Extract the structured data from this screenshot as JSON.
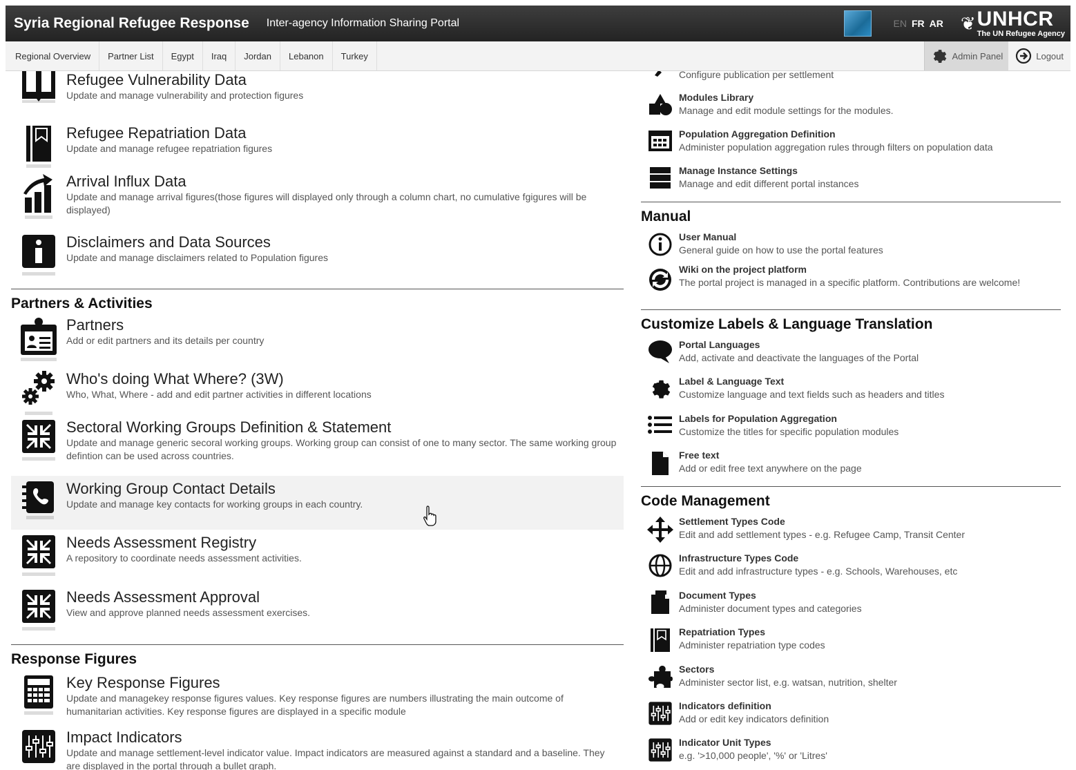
{
  "header": {
    "title": "Syria Regional Refugee Response",
    "subtitle": "Inter-agency Information Sharing Portal",
    "languages": [
      "EN",
      "FR",
      "AR"
    ],
    "logo": {
      "name": "UNHCR",
      "tagline": "The UN Refugee Agency"
    }
  },
  "nav": {
    "items": [
      "Regional Overview",
      "Partner List",
      "Egypt",
      "Iraq",
      "Jordan",
      "Lebanon",
      "Turkey"
    ],
    "admin_label": "Admin Panel",
    "logout_label": "Logout"
  },
  "left": {
    "top_items": [
      {
        "title": "Refugee Vulnerability Data",
        "desc": "Update and manage vulnerability and protection figures",
        "icon": "book-icon"
      },
      {
        "title": "Refugee Repatriation Data",
        "desc": "Update and manage refugee repatriation figures",
        "icon": "bookmark-icon"
      },
      {
        "title": "Arrival Influx Data",
        "desc": "Update and manage arrival figures(those figures will displayed only through a column chart, no cumulative fgigures will be displayed)",
        "icon": "chart-up-icon"
      },
      {
        "title": "Disclaimers and Data Sources",
        "desc": "Update and manage disclaimers related to Population figures",
        "icon": "info-icon"
      }
    ],
    "partners_section": {
      "title": "Partners & Activities",
      "items": [
        {
          "title": "Partners",
          "desc": "Add or edit partners and its details per country",
          "icon": "id-card-icon"
        },
        {
          "title": "Who's doing What Where? (3W)",
          "desc": "Who, What, Where - add and edit partner activities in different locations",
          "icon": "gears-icon"
        },
        {
          "title": "Sectoral Working Groups Definition & Statement",
          "desc": "Update and manage generic secoral working groups. Working group can consist of one to many sector. The same working group defintion can be used across countries.",
          "icon": "compress-icon"
        },
        {
          "title": "Working Group Contact Details",
          "desc": "Update and manage key contacts for working groups in each country.",
          "icon": "address-book-icon"
        },
        {
          "title": "Needs Assessment Registry",
          "desc": "A repository to coordinate needs assessment activities.",
          "icon": "compress-icon"
        },
        {
          "title": "Needs Assessment Approval",
          "desc": "View and approve planned needs assessment exercises.",
          "icon": "compress-icon"
        }
      ]
    },
    "response_section": {
      "title": "Response Figures",
      "items": [
        {
          "title": "Key Response Figures",
          "desc": "Update and managekey response figures values. Key response figures are numbers illustrating the main outcome of humanitarian activities. Key response figures are displayed in a specific module",
          "icon": "calculator-icon"
        },
        {
          "title": "Impact Indicators",
          "desc": "Update and manage settlement-level indicator value. Impact indicators are measured against a standard and a baseline. They are displayed in the portal through a bullet graph.",
          "icon": "sliders-icon"
        }
      ]
    }
  },
  "right": {
    "top_items": [
      {
        "title": "",
        "desc": "Configure publication per settlement",
        "icon": "brush-icon"
      },
      {
        "title": "Modules Library",
        "desc": "Manage and edit module settings for the modules.",
        "icon": "shapes-icon"
      },
      {
        "title": "Population Aggregation Definition",
        "desc": "Administer population aggregation rules through filters on population data",
        "icon": "calendar-grid-icon"
      },
      {
        "title": "Manage Instance Settings",
        "desc": "Manage and edit different portal instances",
        "icon": "server-icon"
      }
    ],
    "manual_section": {
      "title": "Manual",
      "items": [
        {
          "title": "User Manual",
          "desc": "General guide on how to use the portal features",
          "icon": "info-circle-icon"
        },
        {
          "title": "Wiki on the project platform",
          "desc": "The portal project is managed in a specific platform. Contributions are welcome!",
          "icon": "sync-icon"
        }
      ]
    },
    "labels_section": {
      "title": "Customize Labels & Language Translation",
      "items": [
        {
          "title": "Portal Languages",
          "desc": "Add, activate and deactivate the languages of the Portal",
          "icon": "speech-bubble-icon"
        },
        {
          "title": "Label & Language Text",
          "desc": "Customize language and text fields such as headers and titles",
          "icon": "gear-icon"
        },
        {
          "title": "Labels for Population Aggregation",
          "desc": "Customize the titles for specific population modules",
          "icon": "list-icon"
        },
        {
          "title": "Free text",
          "desc": "Add or edit free text anywhere on the page",
          "icon": "file-icon"
        }
      ]
    },
    "code_section": {
      "title": "Code Management",
      "items": [
        {
          "title": "Settlement Types Code",
          "desc": "Edit and add settlement types - e.g. Refugee Camp, Transit Center",
          "icon": "move-icon"
        },
        {
          "title": "Infrastructure Types Code",
          "desc": "Edit and add infrastructure types - e.g. Schools, Warehouses, etc",
          "icon": "globe-icon"
        },
        {
          "title": "Document Types",
          "desc": "Administer document types and categories",
          "icon": "documents-icon"
        },
        {
          "title": "Repatriation Types",
          "desc": "Administer repatriation type codes",
          "icon": "bookmark-icon"
        },
        {
          "title": "Sectors",
          "desc": "Administer sector list, e.g. watsan, nutrition, shelter",
          "icon": "puzzle-icon"
        },
        {
          "title": "Indicators definition",
          "desc": "Add or edit key indicators definition",
          "icon": "sliders-icon"
        },
        {
          "title": "Indicator Unit Types",
          "desc": "e.g. '>10,000 people', '%' or 'Litres'",
          "icon": "sliders-icon"
        }
      ]
    }
  }
}
